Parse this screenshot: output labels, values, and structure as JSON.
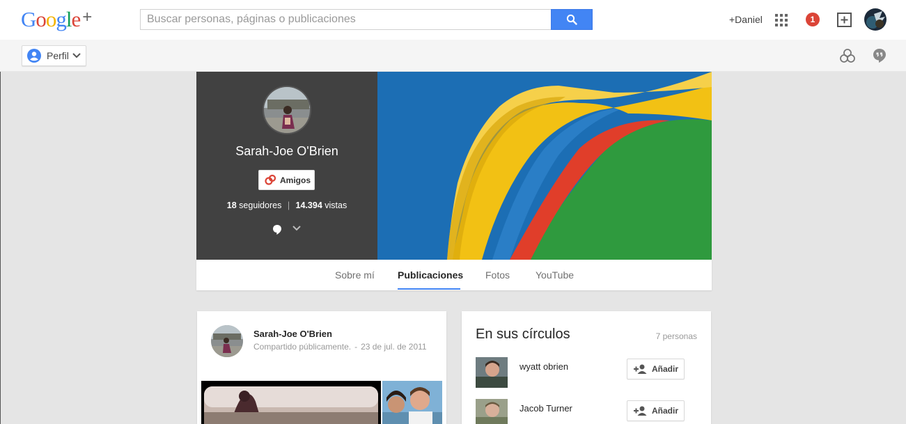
{
  "header": {
    "logo_text": "Google",
    "logo_plus": "+",
    "search_placeholder": "Buscar personas, páginas o publicaciones",
    "user_link": "+Daniel",
    "notification_count": "1"
  },
  "subbar": {
    "perfil_label": "Perfil"
  },
  "profile": {
    "name": "Sarah-Joe O'Brien",
    "relation_button": "Amigos",
    "followers_count": "18",
    "followers_label": "seguidores",
    "separator": "|",
    "views_count": "14.394",
    "views_label": "vistas"
  },
  "tabs": [
    {
      "label": "Sobre mí",
      "active": false
    },
    {
      "label": "Publicaciones",
      "active": true
    },
    {
      "label": "Fotos",
      "active": false
    },
    {
      "label": "YouTube",
      "active": false
    }
  ],
  "post": {
    "author": "Sarah-Joe O'Brien",
    "visibility": "Compartido públicamente.",
    "separator": "-",
    "date": "23 de jul. de 2011"
  },
  "circles": {
    "title": "En sus círculos",
    "count": "7 personas",
    "people": [
      {
        "name": "wyatt obrien",
        "button": "Añadir"
      },
      {
        "name": "Jacob Turner",
        "button": "Añadir"
      }
    ]
  },
  "colors": {
    "accent": "#4285f4",
    "notification": "#db4437",
    "profile_panel": "#414141"
  }
}
